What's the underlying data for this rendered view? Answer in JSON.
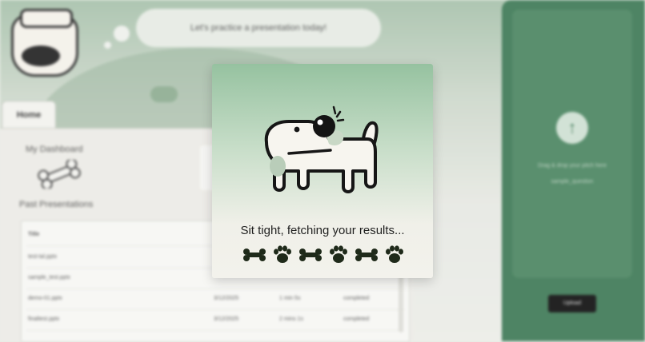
{
  "header": {
    "speech_text": "Let's practice a presentation today!"
  },
  "tabs": [
    {
      "label": "Home"
    }
  ],
  "dashboard": {
    "title": "My Dashboard",
    "past_title": "Past Presentations"
  },
  "table": {
    "header": [
      "Title",
      "",
      "",
      ""
    ],
    "rows": [
      [
        "test-tal.pptx",
        "",
        "",
        ""
      ],
      [
        "sample_test.pptx",
        "",
        "",
        ""
      ],
      [
        "demo-01.pptx",
        "3/12/2025",
        "1 min 5s",
        "completed"
      ],
      [
        "finaltest.pptx",
        "3/12/2025",
        "2 mins 1s",
        "completed"
      ]
    ]
  },
  "upload": {
    "drop_text_line1": "Drag & drop your pitch here",
    "drop_text_line2": "sample_question",
    "button_label": "Upload"
  },
  "modal": {
    "message": "Sit tight, fetching your results...",
    "loader_icons": [
      "bone-icon",
      "paw-icon",
      "bone-icon",
      "paw-icon",
      "bone-icon",
      "paw-icon"
    ]
  },
  "colors": {
    "accent_green": "#3f7a57",
    "modal_top": "#96c2a0",
    "icon_dark": "#1f2a1a"
  }
}
